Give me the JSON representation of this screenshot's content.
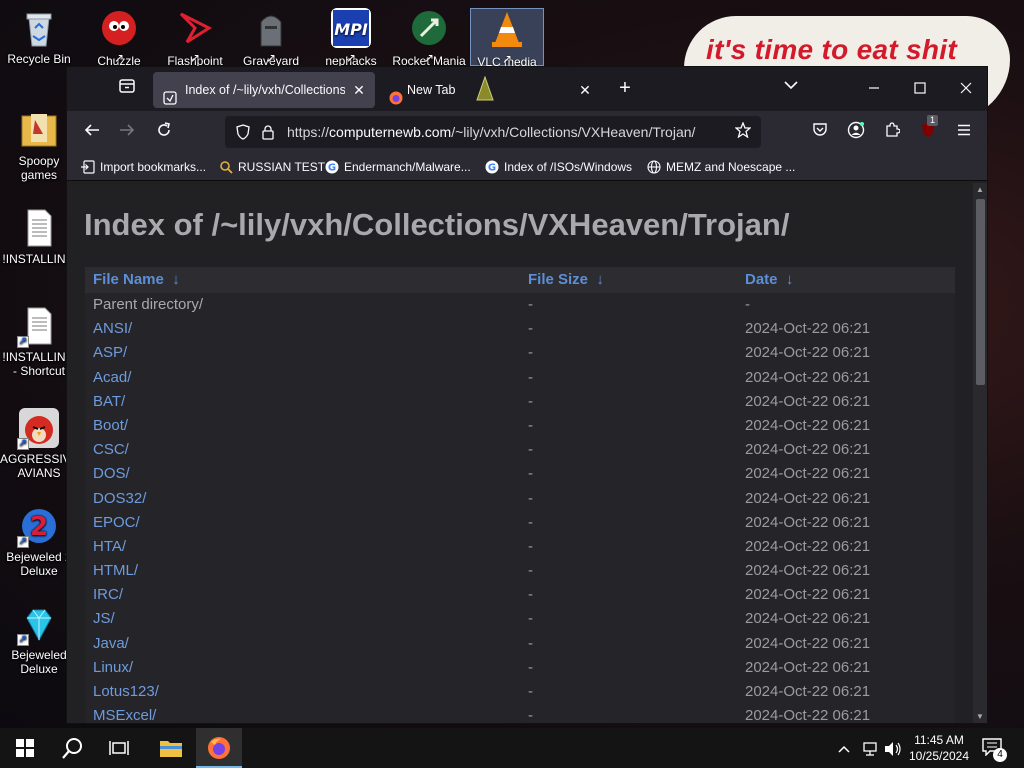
{
  "desktop": {
    "caption": "it's time to eat shit",
    "left_icons": [
      {
        "label": "Recycle Bin"
      },
      {
        "label": "Spoopy\ngames"
      },
      {
        "label": "!INSTALLIN..."
      },
      {
        "label": "!INSTALLIN...\n- Shortcut"
      },
      {
        "label": "AGGRESSIVE\nAVIANS"
      },
      {
        "label": "Bejeweled 2\nDeluxe"
      },
      {
        "label": "Bejeweled\nDeluxe"
      }
    ],
    "top_icons": [
      {
        "label": "Chuzzle"
      },
      {
        "label": "Flashpoint"
      },
      {
        "label": "Graveyard"
      },
      {
        "label": "nephacks"
      },
      {
        "label": "Rocket Mania"
      },
      {
        "label": "VLC media"
      }
    ]
  },
  "browser": {
    "tabs": [
      {
        "title": "Index of /~lily/vxh/Collections/",
        "close": "✕"
      },
      {
        "title": "New Tab",
        "close": "✕"
      }
    ],
    "new_tab": "+",
    "window_controls": {
      "minimize": "—",
      "maximize": "☐",
      "close": "✕"
    },
    "url": {
      "scheme": "https://",
      "host": "computernewb.com",
      "path": "/~lily/vxh/Collections/VXHeaven/Trojan/"
    },
    "extension_badge": "1",
    "bookmarks": [
      {
        "label": "Import bookmarks..."
      },
      {
        "label": "RUSSIAN TEST"
      },
      {
        "label": "Endermanch/Malware..."
      },
      {
        "label": "Index of /ISOs/Windows"
      },
      {
        "label": "MEMZ and Noescape ..."
      }
    ]
  },
  "page": {
    "title": "Index of /~lily/vxh/Collections/VXHeaven/Trojan/",
    "columns": {
      "name": "File Name",
      "size": "File Size",
      "date": "Date",
      "sort_arrow": "↓"
    },
    "rows": [
      {
        "name": "Parent directory/",
        "size": "-",
        "date": "-"
      },
      {
        "name": "ANSI/",
        "size": "-",
        "date": "2024-Oct-22 06:21"
      },
      {
        "name": "ASP/",
        "size": "-",
        "date": "2024-Oct-22 06:21"
      },
      {
        "name": "Acad/",
        "size": "-",
        "date": "2024-Oct-22 06:21"
      },
      {
        "name": "BAT/",
        "size": "-",
        "date": "2024-Oct-22 06:21"
      },
      {
        "name": "Boot/",
        "size": "-",
        "date": "2024-Oct-22 06:21"
      },
      {
        "name": "CSC/",
        "size": "-",
        "date": "2024-Oct-22 06:21"
      },
      {
        "name": "DOS/",
        "size": "-",
        "date": "2024-Oct-22 06:21"
      },
      {
        "name": "DOS32/",
        "size": "-",
        "date": "2024-Oct-22 06:21"
      },
      {
        "name": "EPOC/",
        "size": "-",
        "date": "2024-Oct-22 06:21"
      },
      {
        "name": "HTA/",
        "size": "-",
        "date": "2024-Oct-22 06:21"
      },
      {
        "name": "HTML/",
        "size": "-",
        "date": "2024-Oct-22 06:21"
      },
      {
        "name": "IRC/",
        "size": "-",
        "date": "2024-Oct-22 06:21"
      },
      {
        "name": "JS/",
        "size": "-",
        "date": "2024-Oct-22 06:21"
      },
      {
        "name": "Java/",
        "size": "-",
        "date": "2024-Oct-22 06:21"
      },
      {
        "name": "Linux/",
        "size": "-",
        "date": "2024-Oct-22 06:21"
      },
      {
        "name": "Lotus123/",
        "size": "-",
        "date": "2024-Oct-22 06:21"
      },
      {
        "name": "MSExcel/",
        "size": "-",
        "date": "2024-Oct-22 06:21"
      }
    ]
  },
  "taskbar": {
    "time": "11:45 AM",
    "date": "10/25/2024",
    "notification_count": "4"
  }
}
